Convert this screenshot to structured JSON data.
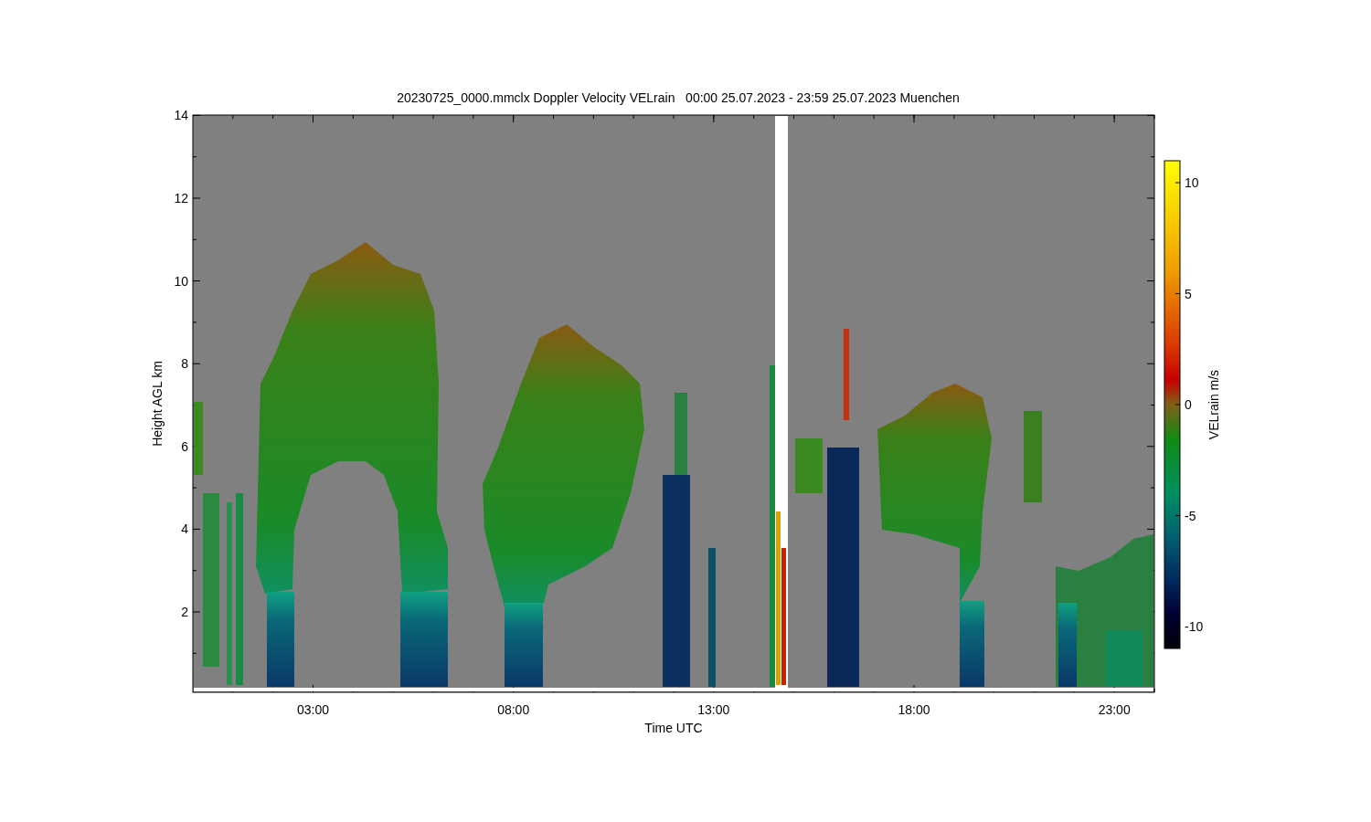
{
  "figure": {
    "title": "20230725_0000.mmclx Doppler Velocity VELrain   00:00 25.07.2023 - 23:59 25.07.2023 Muenchen",
    "xlabel": "Time UTC",
    "ylabel": "Height AGL km",
    "xticks": [
      "03:00",
      "08:00",
      "13:00",
      "18:00",
      "23:00"
    ],
    "yticks": [
      "14",
      "12",
      "10",
      "8",
      "6",
      "4",
      "2"
    ]
  },
  "colorbar": {
    "label": "VELrain m/s",
    "ticks": [
      "10",
      "5",
      "0",
      "-5",
      "-10"
    ]
  }
}
